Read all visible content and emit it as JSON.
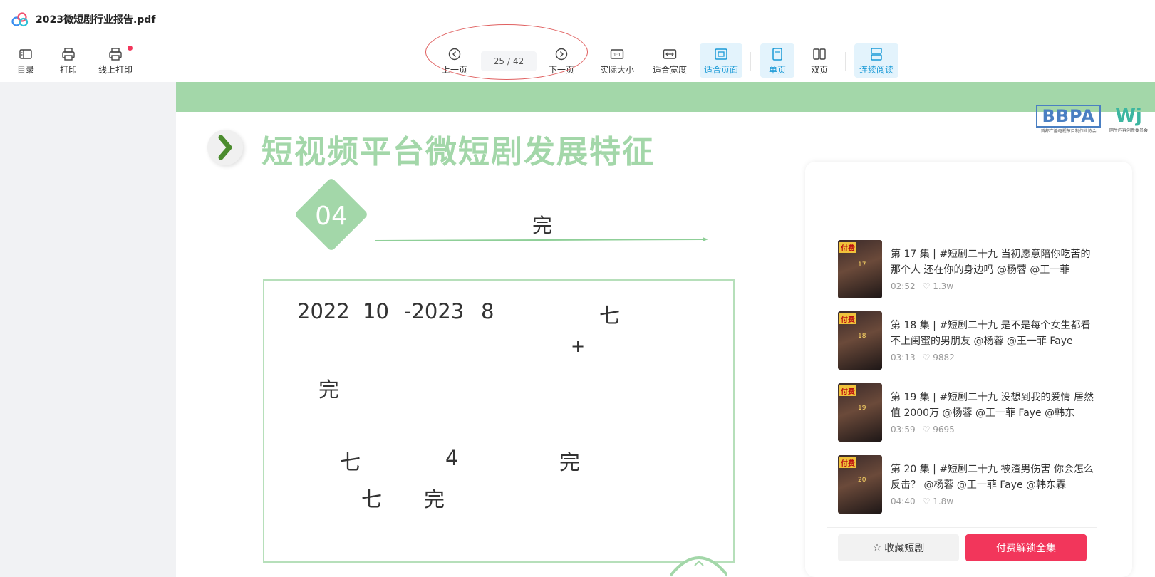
{
  "app": {
    "title": "2023微短剧行业报告.pdf",
    "logo_icon": "cloud-logo-icon"
  },
  "toolbar": {
    "toc_label": "目录",
    "print_label": "打印",
    "online_print_label": "线上打印",
    "prev_label": "上一页",
    "page_current": "25",
    "page_sep": "/",
    "page_total": "42",
    "next_label": "下一页",
    "actual_size_label": "实际大小",
    "fit_width_label": "适合宽度",
    "fit_page_label": "适合页面",
    "single_page_label": "单页",
    "double_page_label": "双页",
    "continuous_label": "连续阅读",
    "accent": "#1a9ad6",
    "notify_color": "#f2365b"
  },
  "slide": {
    "title": "短视频平台微短剧发展特征",
    "section_number": "04",
    "section_label": "完",
    "line1_year1": "2022",
    "line1_month1": "10",
    "line1_year2": "-2023",
    "line1_month2": "8",
    "line1_char": "七",
    "line2_plus": "+",
    "line3_char": "完",
    "line4_char1": "七",
    "line4_num": "4",
    "line4_char2": "完",
    "line5_char1": "七",
    "line5_char2": "完",
    "logo_bbpa": "BBPA",
    "logo_bbpa_sub": "首都广播电视节目制作业协会",
    "logo_wj": "Wj",
    "logo_wj_sub": "网生内容创新委员会",
    "accent_green": "#a3d7a9"
  },
  "phone": {
    "episodes": [
      {
        "title": "第 17 集 | #短剧二十九 当初愿意陪你吃苦的那个人 还在你的身边吗 @杨蓉 @王一菲",
        "duration": "02:52",
        "likes": "1.3w",
        "badge": "付费",
        "num": "17"
      },
      {
        "title": "第 18 集 | #短剧二十九  是不是每个女生都看不上闺蜜的男朋友 @杨蓉 @王一菲 Faye",
        "duration": "03:13",
        "likes": "9882",
        "badge": "付费",
        "num": "18"
      },
      {
        "title": "第 19 集 | #短剧二十九 没想到我的爱情 居然值 2000万 @杨蓉 @王一菲 Faye @韩东",
        "duration": "03:59",
        "likes": "9695",
        "badge": "付费",
        "num": "19"
      },
      {
        "title": "第 20 集 | #短剧二十九 被渣男伤害 你会怎么反击？ @杨蓉 @王一菲 Faye @韩东霖",
        "duration": "04:40",
        "likes": "1.8w",
        "badge": "付费",
        "num": "20"
      }
    ],
    "collect_label": "收藏短剧",
    "unlock_label": "付费解锁全集",
    "unlock_color": "#f2365b"
  }
}
